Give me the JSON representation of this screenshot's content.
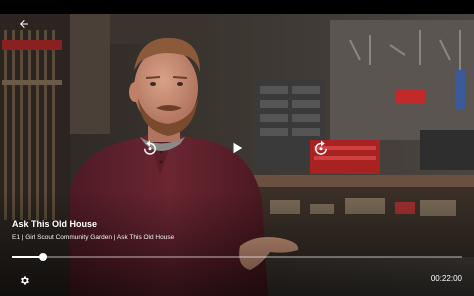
{
  "video": {
    "title": "Ask This Old House",
    "episode_info": "E1  |  Girl Scout Community Garden  |  Ask This Old House",
    "duration": "00:22:00",
    "progress_fraction": 0.069
  },
  "icons": {
    "back": "arrow-left-icon",
    "rewind": "replay-icon",
    "play": "play-icon",
    "forward": "forward-icon",
    "settings": "gear-icon"
  },
  "colors": {
    "shirt": "#6b2632",
    "beard": "#7a4a2e",
    "background_wall": "#3a3530",
    "accent_red": "#c22a2a"
  }
}
